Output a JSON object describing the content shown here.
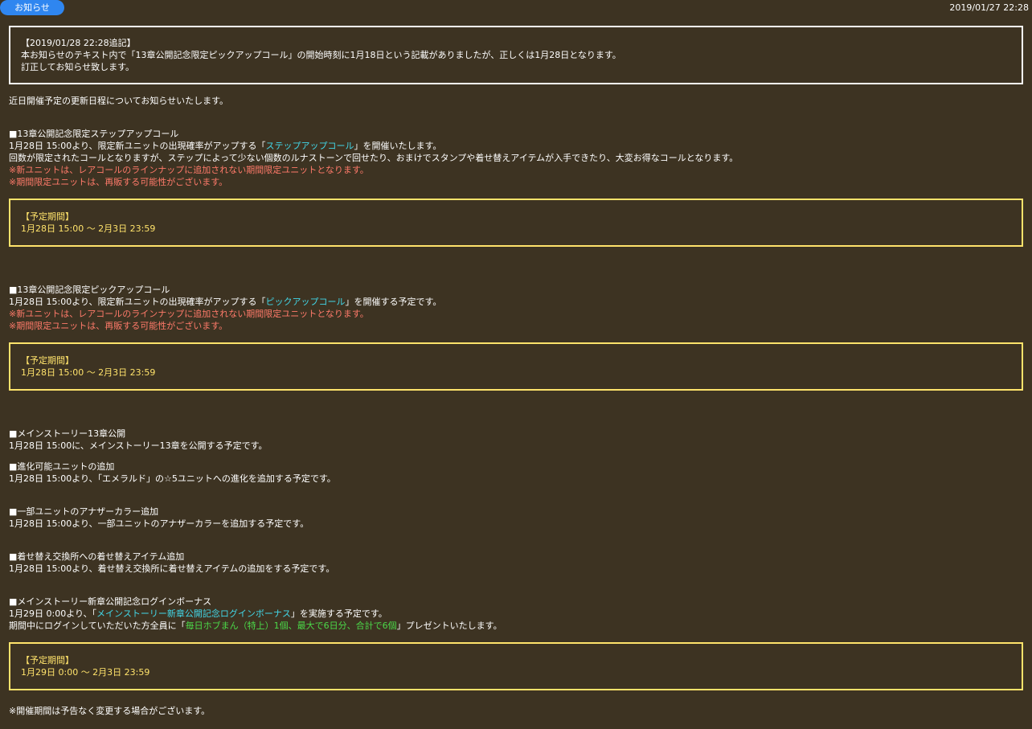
{
  "header": {
    "tag": "お知らせ",
    "date": "2019/01/27 22:28"
  },
  "notice": {
    "line1": "【2019/01/28 22:28追記】",
    "line2": "本お知らせのテキスト内で「13章公開記念限定ピックアップコール」の開始時刻に1月18日という記載がありましたが、正しくは1月28日となります。",
    "line3": "訂正してお知らせ致します。"
  },
  "intro": "近日開催予定の更新日程についてお知らせいたします。",
  "step": {
    "heading": "■13章公開記念限定ステップアップコール",
    "l1_pre": "1月28日 15:00より、限定新ユニットの出現確率がアップする「",
    "l1_link": "ステップアップコール",
    "l1_post": "」を開催いたします。",
    "l2": "回数が限定されたコールとなりますが、ステップによって少ない個数のルナストーンで回せたり、おまけでスタンプや着せ替えアイテムが入手できたり、大変お得なコールとなります。",
    "note1": "※新ユニットは、レアコールのラインナップに追加されない期間限定ユニットとなります。",
    "note2": "※期間限定ユニットは、再販する可能性がございます。",
    "period_label": "【予定期間】",
    "period": "1月28日 15:00 ～ 2月3日 23:59"
  },
  "pickup": {
    "heading": "■13章公開記念限定ピックアップコール",
    "l1_pre": "1月28日 15:00より、限定新ユニットの出現確率がアップする「",
    "l1_link": "ピックアップコール",
    "l1_post": "」を開催する予定です。",
    "note1": "※新ユニットは、レアコールのラインナップに追加されない期間限定ユニットとなります。",
    "note2": "※期間限定ユニットは、再販する可能性がございます。",
    "period_label": "【予定期間】",
    "period": "1月28日 15:00 ～ 2月3日 23:59"
  },
  "story": {
    "heading": "■メインストーリー13章公開",
    "text": "1月28日 15:00に、メインストーリー13章を公開する予定です。"
  },
  "evolve": {
    "heading": "■進化可能ユニットの追加",
    "text": "1月28日 15:00より、「エメラルド」の☆5ユニットへの進化を追加する予定です。"
  },
  "color": {
    "heading": "■一部ユニットのアナザーカラー追加",
    "text": "1月28日 15:00より、一部ユニットのアナザーカラーを追加する予定です。"
  },
  "dress": {
    "heading": "■着せ替え交換所への着せ替えアイテム追加",
    "text": "1月28日 15:00より、着せ替え交換所に着せ替えアイテムの追加をする予定です。"
  },
  "login": {
    "heading": "■メインストーリー新章公開記念ログインボーナス",
    "l1_pre": "1月29日 0:00より、「",
    "l1_link": "メインストーリー新章公開記念ログインボーナス",
    "l1_post": "」を実施する予定です。",
    "l2_pre": "期間中にログインしていただいた方全員に「",
    "l2_green": "毎日ホブまん（特上）1個、最大で6日分、合計で6個",
    "l2_post": "」プレゼントいたします。",
    "period_label": "【予定期間】",
    "period": "1月29日 0:00 ～ 2月3日 23:59"
  },
  "footer_note": "※開催期間は予告なく変更する場合がございます。",
  "colors": {
    "background": "#3d3322",
    "tag": "#2f86f0",
    "period_border": "#ffe36b",
    "red": "#ff7a6a",
    "link": "#42d7e8",
    "green": "#4bd949"
  }
}
